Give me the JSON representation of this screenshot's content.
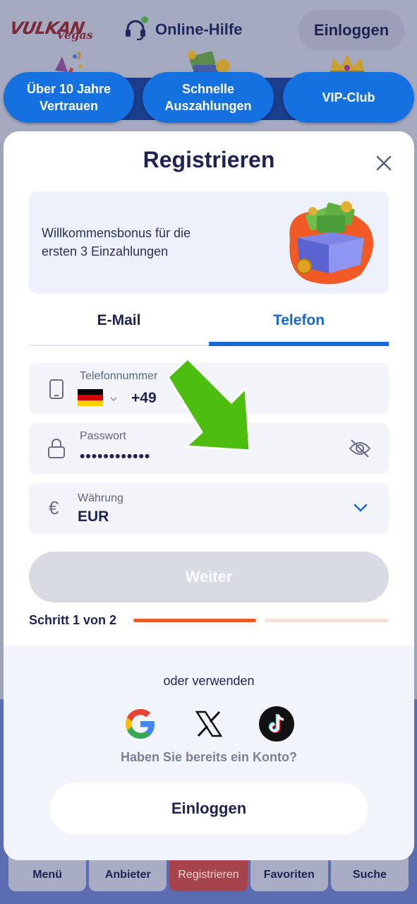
{
  "header": {
    "logo_main": "VULKAN",
    "logo_sub": "Vegas",
    "help_label": "Online-Hilfe",
    "login_label": "Einloggen"
  },
  "promo_chips": [
    {
      "label": "Über 10 Jahre Vertrauen",
      "icon": "confetti-icon"
    },
    {
      "label": "Schnelle Auszahlungen",
      "icon": "money-wallet-icon"
    },
    {
      "label": "VIP-Club",
      "icon": "crown-icon"
    }
  ],
  "bottom_nav": [
    {
      "label": "Menü",
      "icon": "menu-icon"
    },
    {
      "label": "Anbieter",
      "icon": "providers-icon"
    },
    {
      "label": "Registrieren",
      "icon": "gift-icon",
      "active": true
    },
    {
      "label": "Favoriten",
      "icon": "star-icon"
    },
    {
      "label": "Suche",
      "icon": "search-icon"
    }
  ],
  "modal": {
    "title": "Registrieren",
    "close_icon": "close-icon",
    "bonus_text": "Willkommensbonus für die ersten 3 Einzahlungen",
    "tabs": {
      "email": "E-Mail",
      "phone": "Telefon",
      "active": "phone"
    },
    "phone_field": {
      "label": "Telefonnummer",
      "country_code": "+49",
      "country": "Germany"
    },
    "password_field": {
      "label": "Passwort",
      "value": "••••••••••••"
    },
    "currency_field": {
      "label": "Währung",
      "value": "EUR",
      "symbol": "€"
    },
    "next_button": "Weiter",
    "step": {
      "label": "Schritt 1 von 2",
      "current": 1,
      "total": 2
    },
    "alt_login_label": "oder verwenden",
    "social": [
      "google-icon",
      "x-icon",
      "tiktok-icon"
    ],
    "have_account": "Haben Sie bereits ein Konto?",
    "login_button": "Einloggen"
  },
  "colors": {
    "primary": "#1568d6",
    "title": "#1e2352",
    "progress": "#ee5a25",
    "annotation_arrow": "#4dbd0f"
  }
}
